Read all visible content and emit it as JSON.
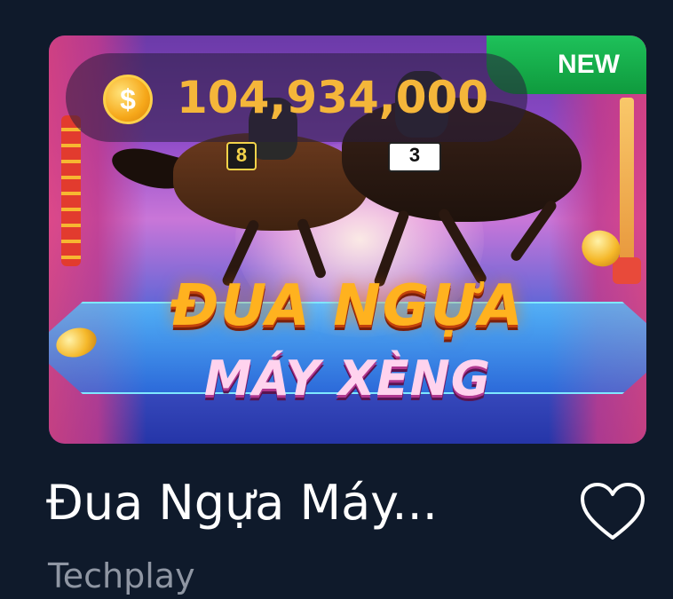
{
  "game": {
    "jackpot": "104,934,000",
    "jackpot_currency_symbol": "$",
    "badge": "NEW",
    "art_title": "ĐUA NGỰA",
    "art_subtitle": "MÁY XÈNG",
    "saddle_number_left": "8",
    "saddle_number_right": "3",
    "title": "Đua Ngựa Máy...",
    "provider": "Techplay",
    "favorite_icon": "heart-outline-icon"
  },
  "colors": {
    "background": "#0f1a2b",
    "jackpot_text": "#f4b63a",
    "badge_green": "#1ec15a",
    "title_text": "#ffffff",
    "provider_text": "#8f96a3"
  }
}
